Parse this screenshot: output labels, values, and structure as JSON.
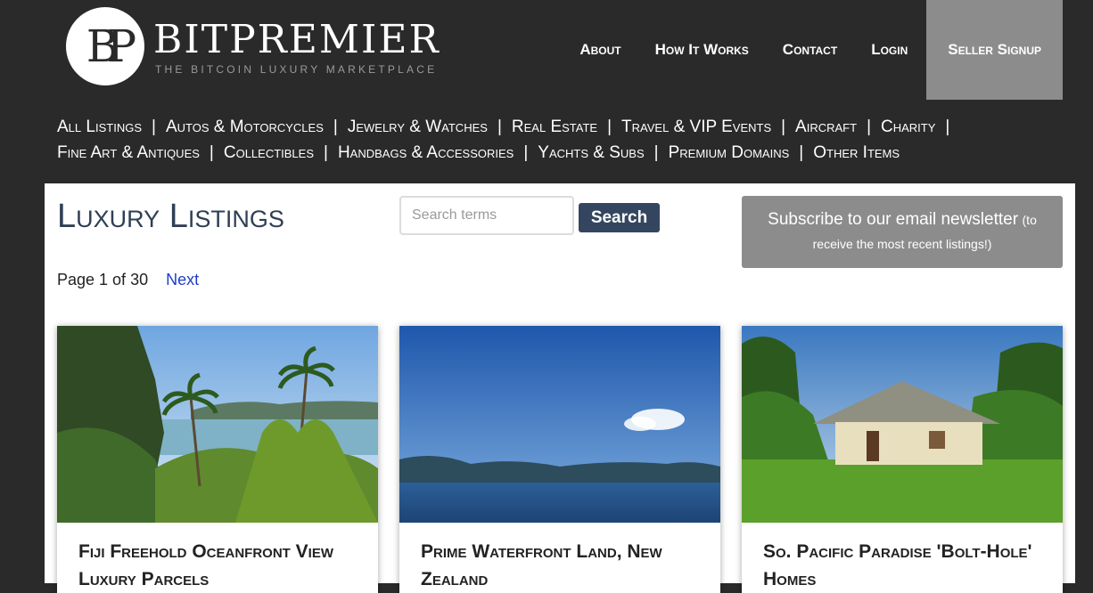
{
  "brand": {
    "monogram": "BP",
    "name": "BitPremier",
    "tagline": "THE BITCOIN LUXURY MARKETPLACE"
  },
  "top_nav": {
    "about": "About",
    "how_it_works": "How It Works",
    "contact": "Contact",
    "login": "Login",
    "seller_signup": "Seller Signup"
  },
  "categories": {
    "row1": [
      "All Listings",
      "Autos & Motorcycles",
      "Jewelry & Watches",
      "Real Estate",
      "Travel & VIP Events",
      "Aircraft",
      "Charity"
    ],
    "row2": [
      "Fine Art & Antiques",
      "Collectibles",
      "Handbags & Accessories",
      "Yachts & Subs",
      "Premium Domains",
      "Other Items"
    ],
    "separator": "|"
  },
  "main": {
    "title": "Luxury Listings",
    "search": {
      "placeholder": "Search terms",
      "button": "Search"
    },
    "subscribe": {
      "headline": "Subscribe to our email newsletter",
      "note": "(to receive the most recent listings!)"
    },
    "pager": {
      "text": "Page 1 of 30",
      "next": "Next"
    }
  },
  "listings": [
    {
      "title": "Fiji Freehold Oceanfront View Luxury Parcels",
      "image": "tropical-bay-palms"
    },
    {
      "title": "Prime Waterfront Land, New Zealand",
      "image": "lake-mountains-sky"
    },
    {
      "title": "So. Pacific Paradise 'Bolt-Hole' Homes",
      "image": "bungalow-lawn"
    }
  ],
  "colors": {
    "header_bg": "#2a2a2a",
    "seller_bg": "#8c8c8c",
    "title": "#2f3f55",
    "search_button": "#34465f",
    "link": "#1c3ec8"
  }
}
